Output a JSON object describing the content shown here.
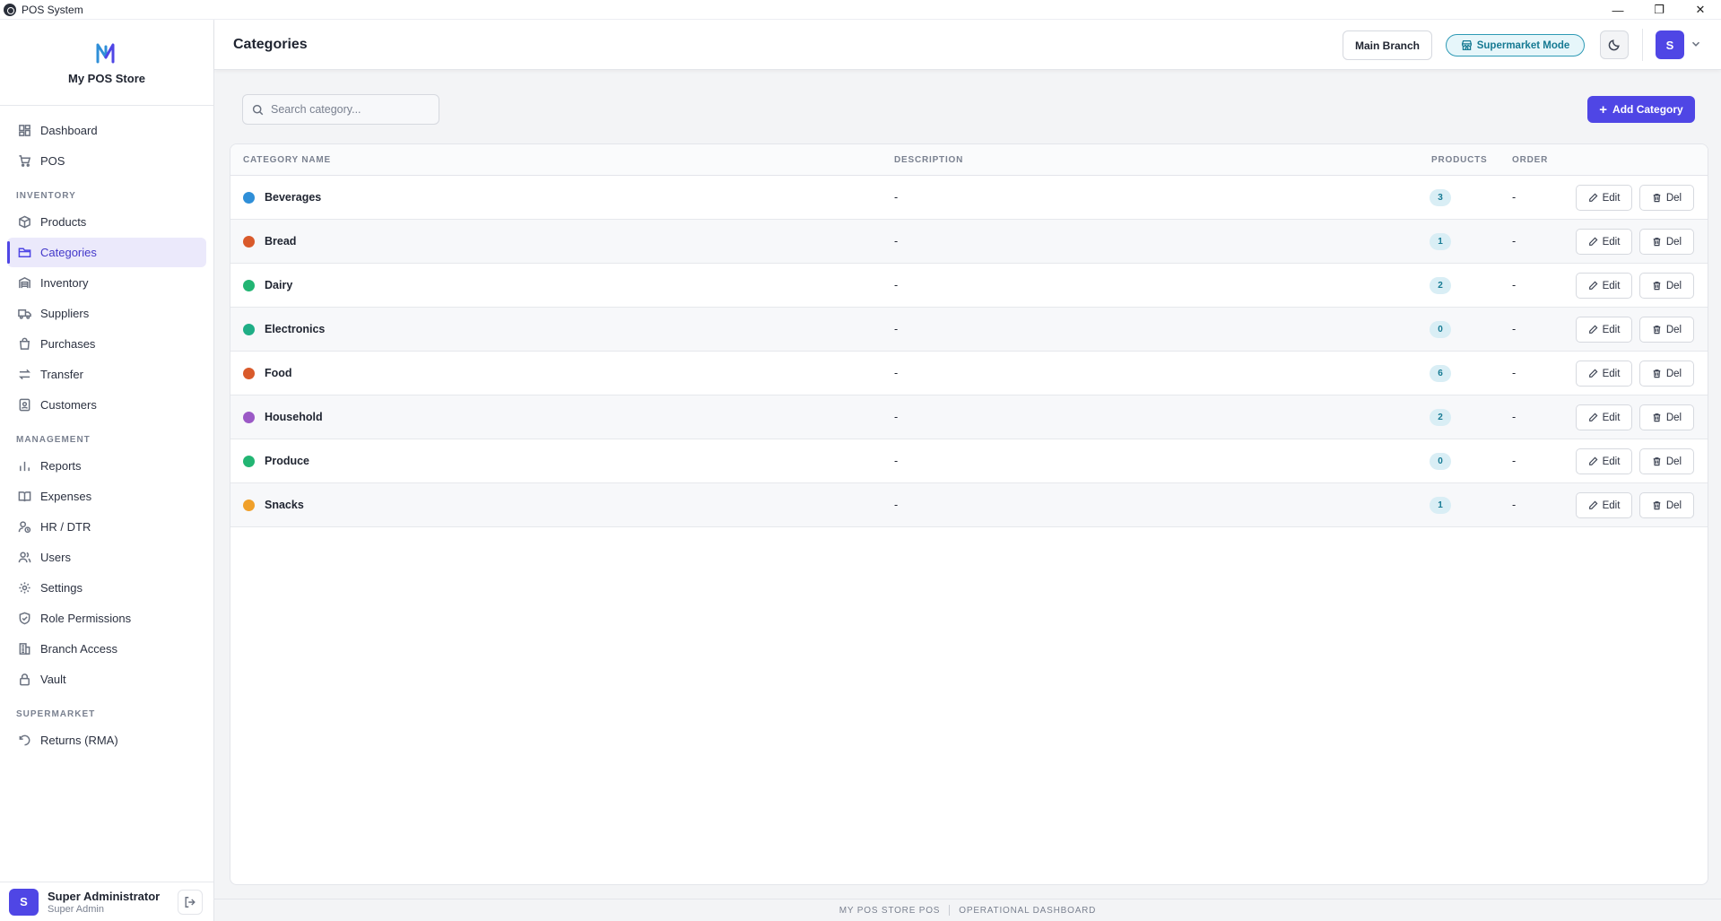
{
  "window": {
    "title": "POS System",
    "controls": {
      "minimize": "—",
      "restore": "❐",
      "close": "✕"
    }
  },
  "sidebar": {
    "brand_name": "My POS Store",
    "sections": {
      "inventory": "INVENTORY",
      "management": "MANAGEMENT",
      "supermarket": "SUPERMARKET"
    },
    "items": {
      "dashboard": "Dashboard",
      "pos": "POS",
      "products": "Products",
      "categories": "Categories",
      "inventory": "Inventory",
      "suppliers": "Suppliers",
      "purchases": "Purchases",
      "transfer": "Transfer",
      "customers": "Customers",
      "reports": "Reports",
      "expenses": "Expenses",
      "hr_dtr": "HR / DTR",
      "users": "Users",
      "settings": "Settings",
      "role_permissions": "Role Permissions",
      "branch_access": "Branch Access",
      "vault": "Vault",
      "returns": "Returns (RMA)"
    },
    "active_item": "Categories",
    "user": {
      "initial": "S",
      "name": "Super Administrator",
      "role": "Super Admin"
    }
  },
  "header": {
    "title": "Categories",
    "branch_button": "Main Branch",
    "mode_button": "Supermarket Mode",
    "avatar_initial": "S"
  },
  "toolbar": {
    "search_placeholder": "Search category...",
    "search_value": "",
    "add_button": "Add Category"
  },
  "table": {
    "columns": {
      "name": "CATEGORY NAME",
      "description": "DESCRIPTION",
      "products": "PRODUCTS",
      "order": "ORDER"
    },
    "edit_label": "Edit",
    "delete_label": "Del",
    "rows": [
      {
        "name": "Beverages",
        "description": "-",
        "products": "3",
        "order": "-",
        "color": "#2f8fd8"
      },
      {
        "name": "Bread",
        "description": "-",
        "products": "1",
        "order": "-",
        "color": "#d95a2b"
      },
      {
        "name": "Dairy",
        "description": "-",
        "products": "2",
        "order": "-",
        "color": "#22b573"
      },
      {
        "name": "Electronics",
        "description": "-",
        "products": "0",
        "order": "-",
        "color": "#1fae86"
      },
      {
        "name": "Food",
        "description": "-",
        "products": "6",
        "order": "-",
        "color": "#d95a2b"
      },
      {
        "name": "Household",
        "description": "-",
        "products": "2",
        "order": "-",
        "color": "#9b59c6"
      },
      {
        "name": "Produce",
        "description": "-",
        "products": "0",
        "order": "-",
        "color": "#22b573"
      },
      {
        "name": "Snacks",
        "description": "-",
        "products": "1",
        "order": "-",
        "color": "#f0a02a"
      }
    ]
  },
  "footer": {
    "left": "MY POS STORE POS",
    "right": "OPERATIONAL DASHBOARD"
  },
  "colors": {
    "accent": "#4f46e5",
    "mode_teal": "#167a93"
  }
}
